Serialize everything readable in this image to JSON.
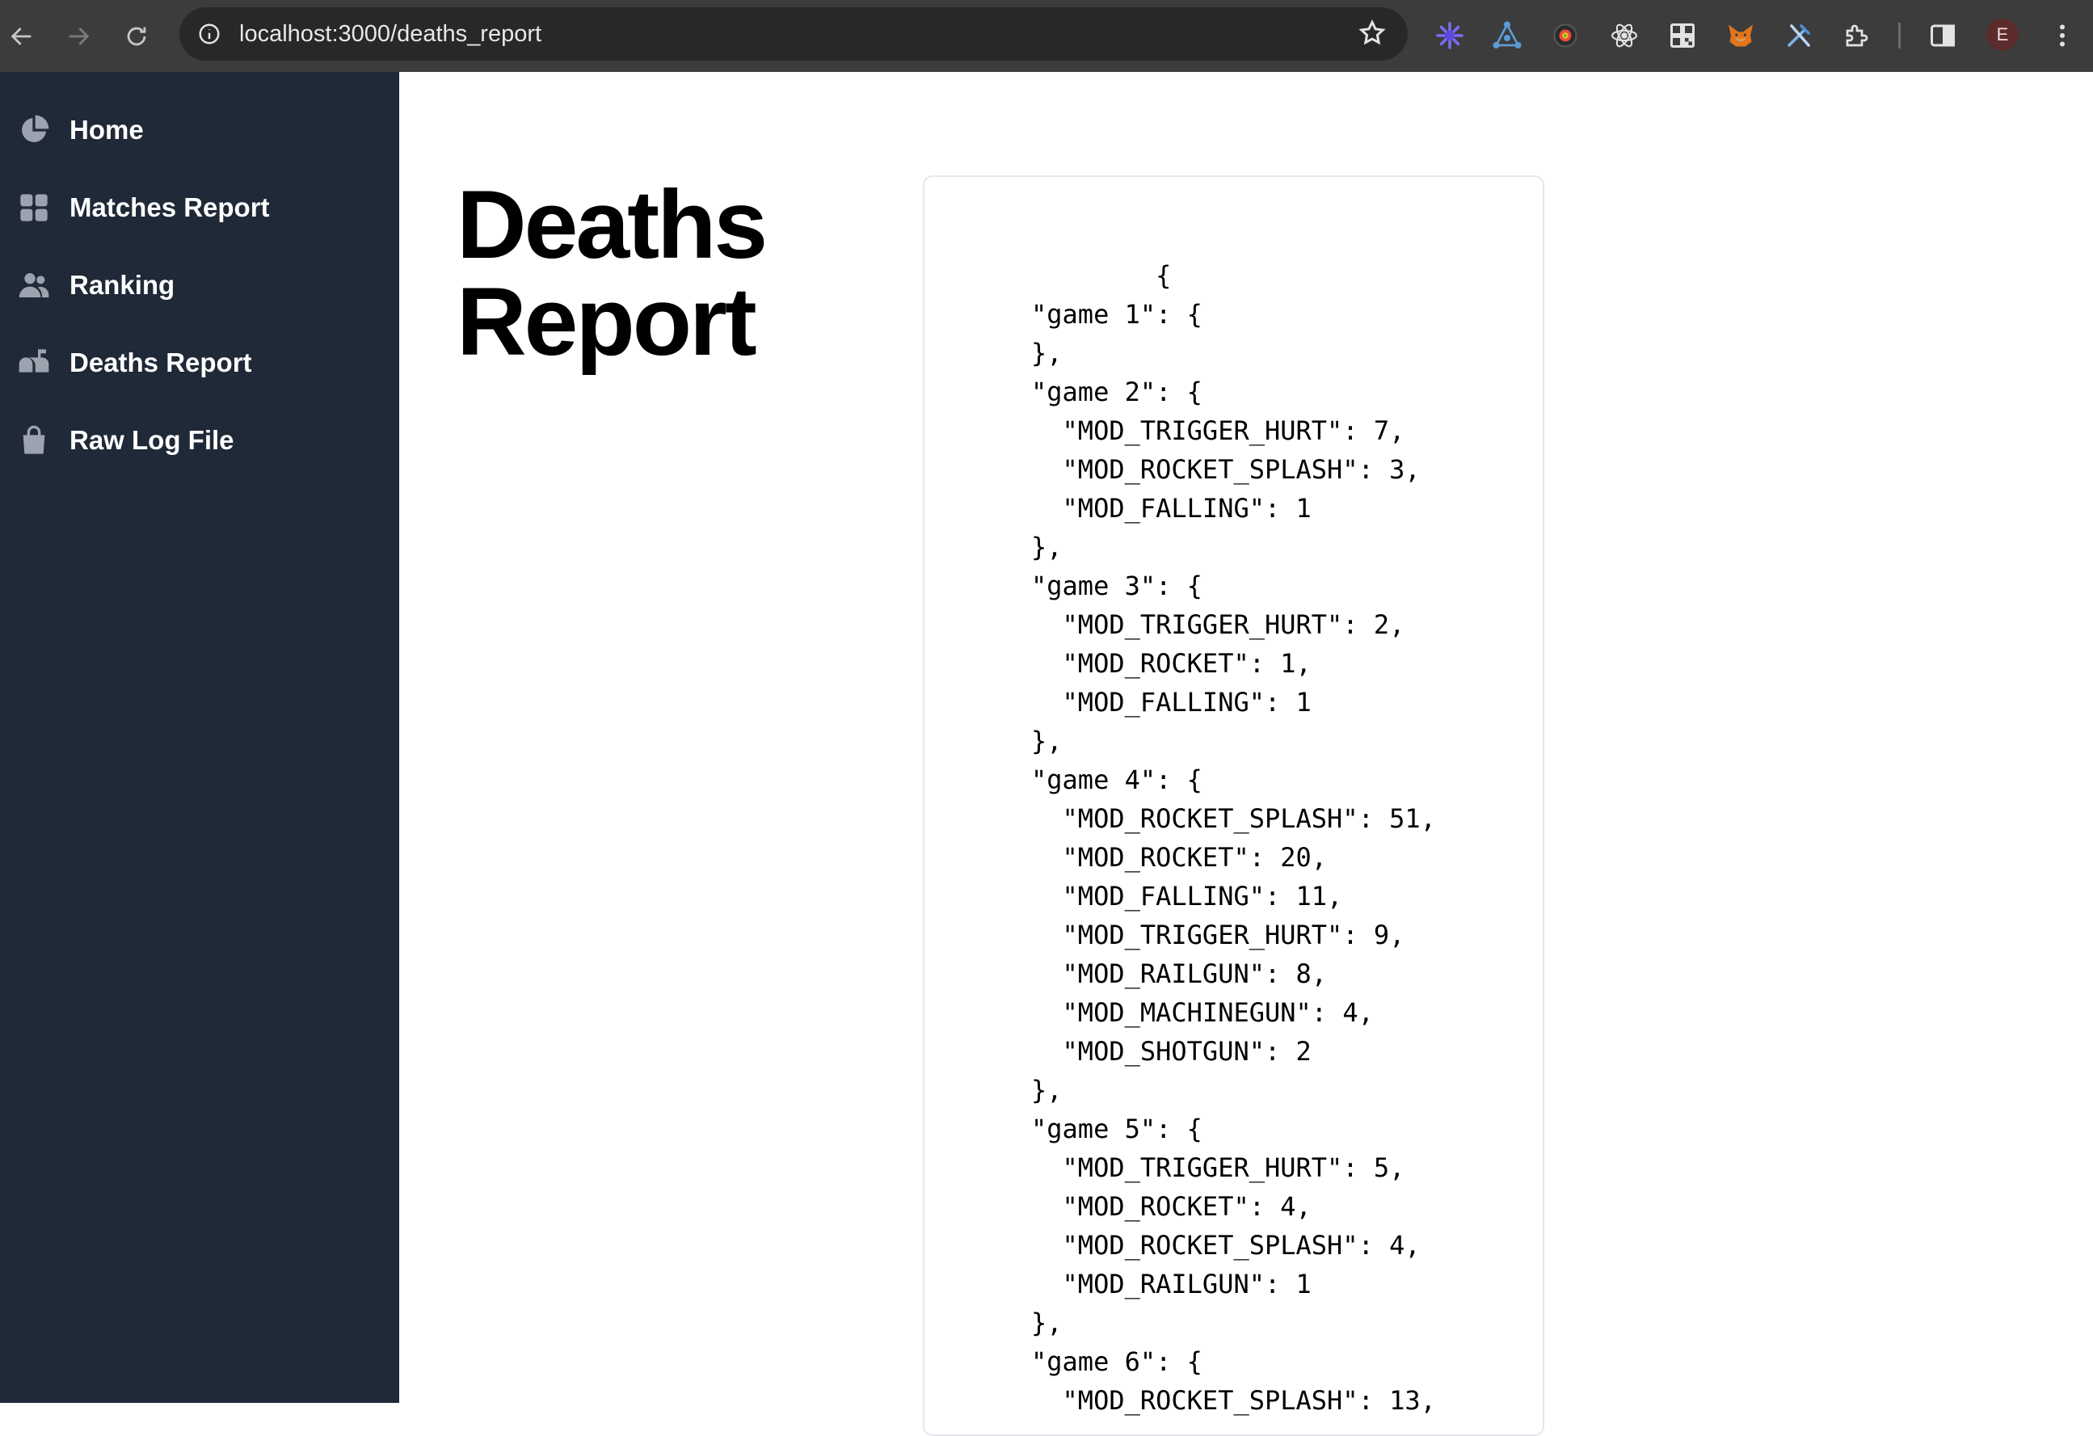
{
  "browser": {
    "url": "localhost:3000/deaths_report",
    "profile_initial": "E",
    "extensions": [
      "sparkle-icon",
      "network-icon",
      "camera-icon",
      "react-icon",
      "qr-icon",
      "fox-icon",
      "tools-icon",
      "puzzle-icon"
    ]
  },
  "sidebar": {
    "items": [
      {
        "label": "Home",
        "icon": "pie-chart-icon"
      },
      {
        "label": "Matches Report",
        "icon": "grid-icon"
      },
      {
        "label": "Ranking",
        "icon": "users-icon"
      },
      {
        "label": "Deaths Report",
        "icon": "mailbox-icon"
      },
      {
        "label": "Raw Log File",
        "icon": "shopping-bag-icon"
      }
    ]
  },
  "main": {
    "title": "Deaths Report",
    "report_json": "        {\n\"game 1\": {\n},\n\"game 2\": {\n  \"MOD_TRIGGER_HURT\": 7,\n  \"MOD_ROCKET_SPLASH\": 3,\n  \"MOD_FALLING\": 1\n},\n\"game 3\": {\n  \"MOD_TRIGGER_HURT\": 2,\n  \"MOD_ROCKET\": 1,\n  \"MOD_FALLING\": 1\n},\n\"game 4\": {\n  \"MOD_ROCKET_SPLASH\": 51,\n  \"MOD_ROCKET\": 20,\n  \"MOD_FALLING\": 11,\n  \"MOD_TRIGGER_HURT\": 9,\n  \"MOD_RAILGUN\": 8,\n  \"MOD_MACHINEGUN\": 4,\n  \"MOD_SHOTGUN\": 2\n},\n\"game 5\": {\n  \"MOD_TRIGGER_HURT\": 5,\n  \"MOD_ROCKET\": 4,\n  \"MOD_ROCKET_SPLASH\": 4,\n  \"MOD_RAILGUN\": 1\n},\n\"game 6\": {\n  \"MOD_ROCKET_SPLASH\": 13,"
  }
}
